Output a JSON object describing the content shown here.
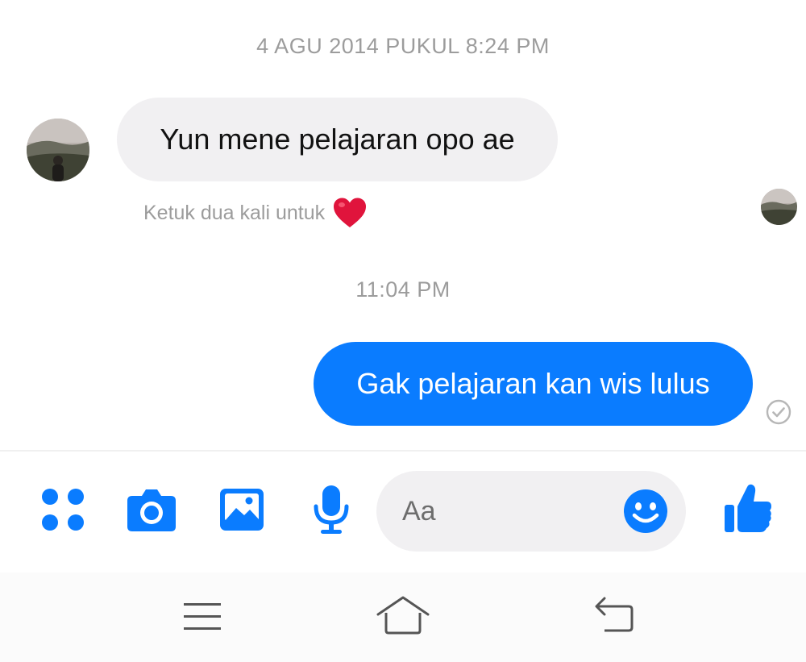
{
  "conversation": {
    "timestamps": [
      "4 AGU 2014 PUKUL 8:24 PM",
      "11:04 PM"
    ],
    "messages": [
      {
        "direction": "incoming",
        "text": "Yun mene pelajaran opo ae"
      },
      {
        "direction": "outgoing",
        "text": "Gak pelajaran kan wis lulus"
      }
    ],
    "reaction_hint": "Ketuk dua kali untuk",
    "reaction_icon": "heart-icon",
    "delivery_status_icon": "check-circle-icon"
  },
  "composer": {
    "placeholder": "Aa",
    "tools": [
      "more-apps-icon",
      "camera-icon",
      "photo-icon",
      "microphone-icon"
    ],
    "emoji_icon": "smiley-icon",
    "send_icon": "thumbs-up-icon"
  },
  "nav_bar": {
    "icons": [
      "menu-icon",
      "home-icon",
      "back-icon"
    ]
  },
  "colors": {
    "accent": "#0a7cff",
    "incoming_bubble": "#f1f0f2",
    "muted_text": "#9c9c9c",
    "heart": "#e0143c"
  }
}
